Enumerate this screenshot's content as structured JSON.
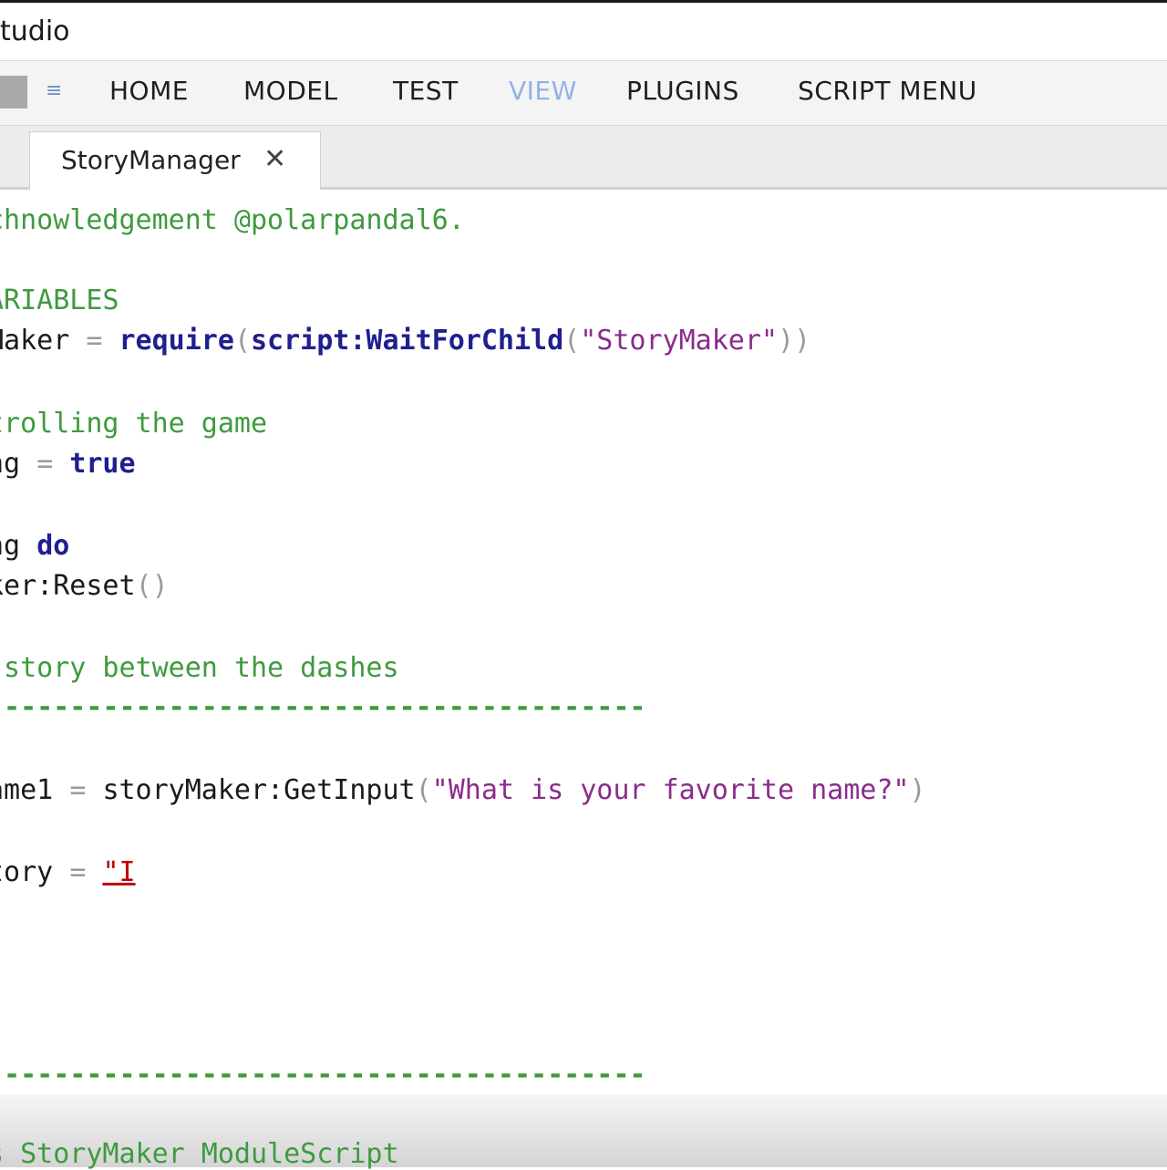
{
  "window": {
    "title": "tudio"
  },
  "ribbon": {
    "tabs": [
      {
        "label": "HOME",
        "active": false
      },
      {
        "label": "MODEL",
        "active": false
      },
      {
        "label": "TEST",
        "active": false
      },
      {
        "label": "VIEW",
        "active": true
      },
      {
        "label": "PLUGINS",
        "active": false
      },
      {
        "label": "SCRIPT MENU",
        "active": false
      }
    ],
    "quick_access_icon": "customize-arrow-icon"
  },
  "document_tab": {
    "label": "StoryManager",
    "close": "✕"
  },
  "code": {
    "line1": "chnowledgement @polarpandal6.",
    "line2": "ARIABLES",
    "line3": {
      "a": "Maker ",
      "b": "= ",
      "c": "require",
      "d": "(",
      "e": "script:WaitForChild",
      "f": "(",
      "g": "\"StoryMaker\"",
      "h": "))"
    },
    "line4": "trolling the game",
    "line5": {
      "a": "ng ",
      "b": "= ",
      "c": "true"
    },
    "line6": {
      "a": "ng ",
      "b": "do"
    },
    "line7": {
      "a": "ker:Reset",
      "b": "()"
    },
    "line8": " story between the dashes",
    "line9": "----------------------------------------",
    "line10": {
      "a": "ame1 ",
      "b": "= ",
      "c": "storyMaker:GetInput",
      "d": "(",
      "e": "\"What is your favorite name?\"",
      "f": ")"
    },
    "line11": {
      "a": "tory ",
      "b": "= ",
      "c": "\"I"
    },
    "line12": "----------------------------------------",
    "line13": "s StoryMaker ModuleScript"
  },
  "colors": {
    "comment": "#3f9a3f",
    "keyword": "#1f1f8f",
    "string": "#8a2c8a",
    "active_tab": "#8fb4e3"
  }
}
